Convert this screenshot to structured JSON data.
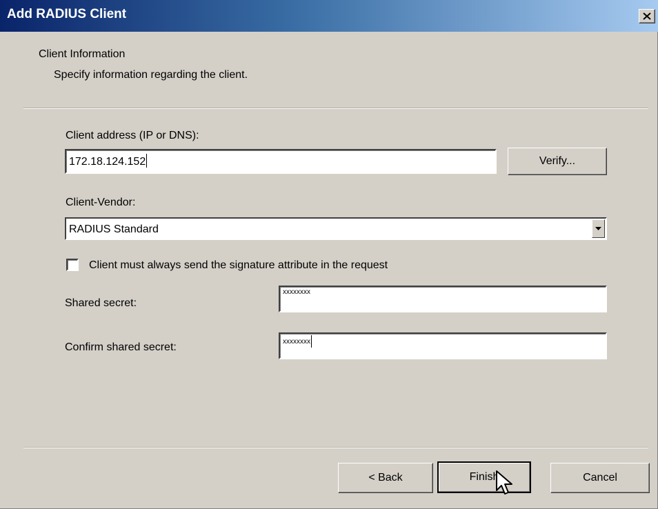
{
  "window": {
    "title": "Add RADIUS Client",
    "close_glyph": "✕"
  },
  "header": {
    "title": "Client Information",
    "subtitle": "Specify information regarding the client."
  },
  "client_address": {
    "label": "Client address (IP or DNS):",
    "value": "172.18.124.152",
    "verify_label": "Verify..."
  },
  "vendor": {
    "label": "Client-Vendor:",
    "selected": "RADIUS Standard"
  },
  "signature_checkbox": {
    "label": "Client must always send the signature attribute in the request",
    "checked": false
  },
  "shared_secret": {
    "label": "Shared secret:",
    "value": "xxxxxxxx"
  },
  "confirm_secret": {
    "label": "Confirm shared secret:",
    "value": "xxxxxxxx"
  },
  "footer": {
    "back_label": "< Back",
    "finish_label": "Finish",
    "cancel_label": "Cancel"
  },
  "colors": {
    "title_gradient_start": "#0a246a",
    "title_gradient_end": "#a6caf0",
    "dialog_face": "#d4d0c8"
  },
  "icons": {
    "close": "close-icon",
    "dropdown": "chevron-down-icon",
    "cursor": "mouse-pointer-icon"
  }
}
